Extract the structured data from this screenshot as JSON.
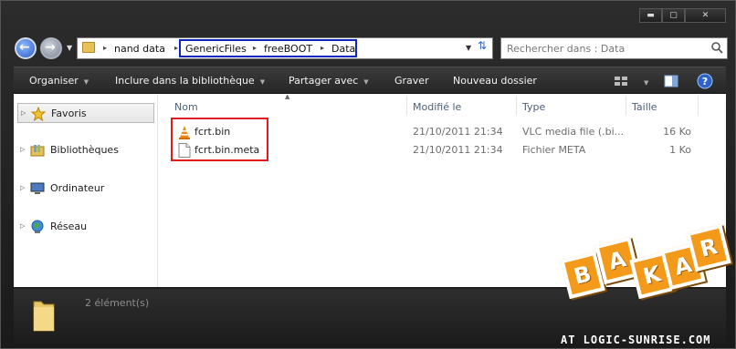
{
  "window": {
    "minimize_label": "▬",
    "maximize_label": "▢",
    "close_label": "✕"
  },
  "address": {
    "crumbs": [
      "nand data",
      "GenericFiles",
      "freeBOOT",
      "Data"
    ],
    "search_placeholder": "Rechercher dans : Data"
  },
  "toolbar": {
    "organize": "Organiser",
    "include_library": "Inclure dans la bibliothèque",
    "share_with": "Partager avec",
    "burn": "Graver",
    "new_folder": "Nouveau dossier"
  },
  "sidebar": {
    "items": [
      {
        "label": "Favoris",
        "icon": "star-icon"
      },
      {
        "label": "Bibliothèques",
        "icon": "library-icon"
      },
      {
        "label": "Ordinateur",
        "icon": "computer-icon"
      },
      {
        "label": "Réseau",
        "icon": "network-icon"
      }
    ]
  },
  "columns": {
    "name": "Nom",
    "modified": "Modifié le",
    "type": "Type",
    "size": "Taille"
  },
  "files": [
    {
      "name": "fcrt.bin",
      "modified": "21/10/2011 21:34",
      "type": "VLC media file (.bi...",
      "size": "16 Ko",
      "icon": "vlc-cone-icon"
    },
    {
      "name": "fcrt.bin.meta",
      "modified": "21/10/2011 21:34",
      "type": "Fichier META",
      "size": "1 Ko",
      "icon": "generic-file-icon"
    }
  ],
  "status": {
    "count_text": "2 élément(s)"
  },
  "watermark": {
    "letters": [
      "B",
      "A",
      "K",
      "A",
      "R"
    ],
    "text": "AT LOGIC-SUNRISE.COM"
  },
  "colors": {
    "highlight_blue": "#1026c0",
    "highlight_red": "#e01b1b",
    "badge_orange": "#f39a1b"
  }
}
